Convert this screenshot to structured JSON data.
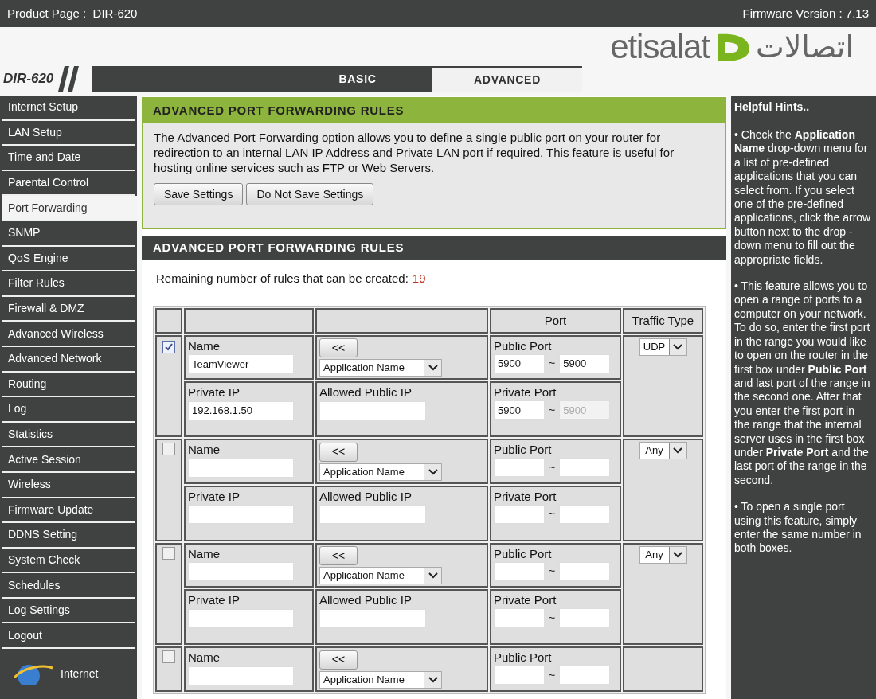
{
  "top_bar": {
    "product": "Product Page :  DIR-620",
    "firmware": "Firmware Version : 7.13"
  },
  "brand": {
    "latin": "etisalat",
    "arabic": "اتصالات"
  },
  "model_logo": "DIR-620",
  "tabs": [
    {
      "label": "BASIC",
      "selected": false
    },
    {
      "label": "ADVANCED",
      "selected": true
    }
  ],
  "sidebar": {
    "items": [
      {
        "label": "Internet Setup",
        "selected": false
      },
      {
        "label": "LAN Setup",
        "selected": false
      },
      {
        "label": "Time and Date",
        "selected": false
      },
      {
        "label": "Parental Control",
        "selected": false
      },
      {
        "label": "Port Forwarding",
        "selected": true
      },
      {
        "label": "SNMP",
        "selected": false
      },
      {
        "label": "QoS Engine",
        "selected": false
      },
      {
        "label": "Filter Rules",
        "selected": false
      },
      {
        "label": "Firewall & DMZ",
        "selected": false
      },
      {
        "label": "Advanced Wireless",
        "selected": false
      },
      {
        "label": "Advanced Network",
        "selected": false
      },
      {
        "label": "Routing",
        "selected": false
      },
      {
        "label": "Log",
        "selected": false
      },
      {
        "label": "Statistics",
        "selected": false
      },
      {
        "label": "Active Session",
        "selected": false
      },
      {
        "label": "Wireless",
        "selected": false
      },
      {
        "label": "Firmware Update",
        "selected": false
      },
      {
        "label": "DDNS Setting",
        "selected": false
      },
      {
        "label": "System Check",
        "selected": false
      },
      {
        "label": "Schedules",
        "selected": false
      },
      {
        "label": "Log Settings",
        "selected": false
      },
      {
        "label": "Logout",
        "selected": false
      }
    ],
    "footer_label": "Internet"
  },
  "intro": {
    "title": "ADVANCED PORT FORWARDING RULES",
    "text": "The Advanced Port Forwarding option allows you to define a single public port on your router for redirection to an internal LAN IP Address and Private LAN port if required. This feature is useful for hosting online services such as FTP or Web Servers.",
    "buttons": [
      "Save Settings",
      "Do Not Save Settings"
    ]
  },
  "rules_section": {
    "title": "ADVANCED PORT FORWARDING RULES",
    "remaining_label": "Remaining number of rules that can be created:",
    "remaining_count": "19",
    "columns": [
      "Port",
      "Traffic Type"
    ],
    "rules": [
      {
        "checked": true,
        "name_label": "Name",
        "name": "TeamViewer",
        "app_button": "<<",
        "app_select": "Application Name",
        "public_port_label": "Public Port",
        "public_port_start": "5900",
        "public_separator": "~",
        "public_port_end": "5900",
        "traffic_type": "UDP",
        "private_ip_label": "Private IP",
        "private_ip": "192.168.1.50",
        "allowed_ip_label": "Allowed Public IP",
        "private_port_label": "Private Port",
        "private_port_start": "5900",
        "private_separator": "~",
        "private_port_end": "5900",
        "private_port_end_disabled": true
      },
      {
        "checked": false,
        "name_label": "Name",
        "app_button": "<<",
        "app_select": "Application Name",
        "public_port_label": "Public Port",
        "public_separator": "~",
        "traffic_type": "Any",
        "private_ip_label": "Private IP",
        "allowed_ip_label": "Allowed Public IP",
        "private_port_label": "Private Port",
        "private_separator": "~",
        "private_port_end_disabled": false
      },
      {
        "checked": false,
        "name_label": "Name",
        "app_button": "<<",
        "app_select": "Application Name",
        "public_port_label": "Public Port",
        "public_separator": "~",
        "traffic_type": "Any",
        "private_ip_label": "Private IP",
        "allowed_ip_label": "Allowed Public IP",
        "private_port_label": "Private Port",
        "private_separator": "~",
        "private_port_end_disabled": false
      },
      {
        "checked": false,
        "name_label": "Name",
        "app_button": "<<",
        "app_select": "Application Name",
        "public_port_label": "Public Port",
        "public_separator": "~"
      }
    ]
  },
  "hints": {
    "title": "Helpful Hints..",
    "paragraphs": [
      "• Check the **Application Name** drop-down menu for a list of pre-defined applications that you can select from. If you select one of the pre-defined applications, click the arrow button next to the drop -down menu to fill out the appropriate fields.",
      "• This feature allows you to open a range of ports to a computer on your network. To do so, enter the first port in the range you would like to open on the router in the first box under **Public Port** and last port of the range in the second one. After that you enter the first port in the range that the internal server uses in the first box under **Private Port** and the last port of the range in the second.",
      "• To open a single port using this feature, simply enter the same number in both boxes."
    ]
  }
}
